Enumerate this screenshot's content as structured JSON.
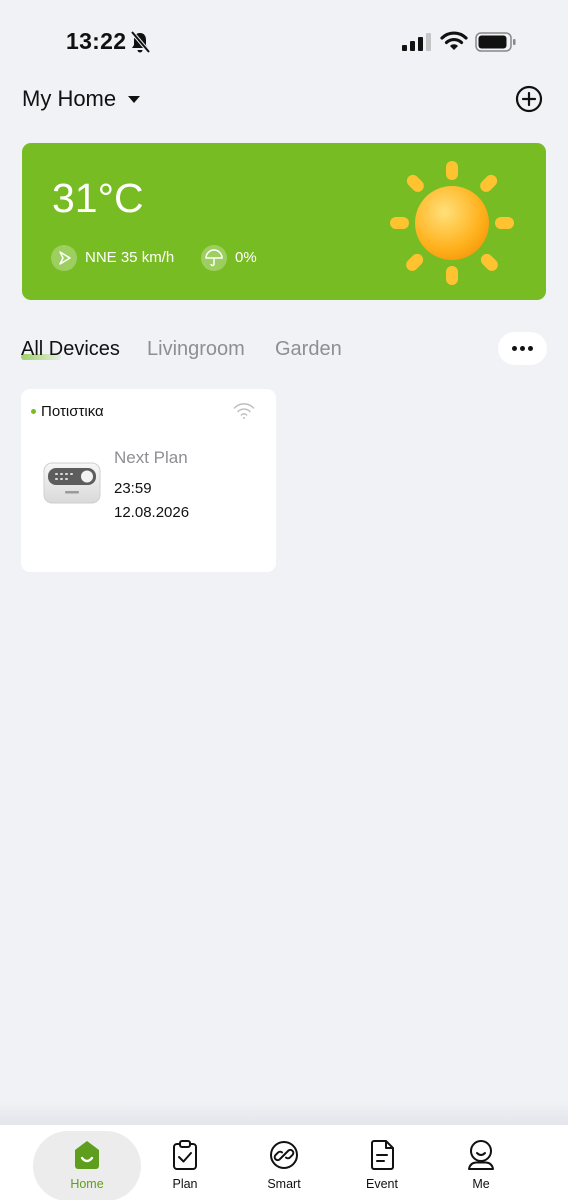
{
  "status_bar": {
    "time": "13:22"
  },
  "header": {
    "home_name": "My Home"
  },
  "weather": {
    "temperature": "31°C",
    "wind": "NNE 35 km/h",
    "rain_chance": "0%",
    "card_color": "#78bc23"
  },
  "tabs": [
    {
      "label": "All Devices",
      "active": true
    },
    {
      "label": "Livingroom",
      "active": false
    },
    {
      "label": "Garden",
      "active": false
    }
  ],
  "device": {
    "name": "Ποτιστικα",
    "next_plan_label": "Next Plan",
    "next_plan_time": "23:59",
    "next_plan_date": "12.08.2026",
    "status_color": "#78bc23"
  },
  "bottom_nav": [
    {
      "label": "Home",
      "icon": "home-icon",
      "active": true
    },
    {
      "label": "Plan",
      "icon": "clipboard-check-icon",
      "active": false
    },
    {
      "label": "Smart",
      "icon": "smart-link-icon",
      "active": false
    },
    {
      "label": "Event",
      "icon": "document-icon",
      "active": false
    },
    {
      "label": "Me",
      "icon": "person-icon",
      "active": false
    }
  ],
  "colors": {
    "accent": "#78bc23",
    "background": "#f1f2f6",
    "nav_active": "#5f9e1d"
  }
}
